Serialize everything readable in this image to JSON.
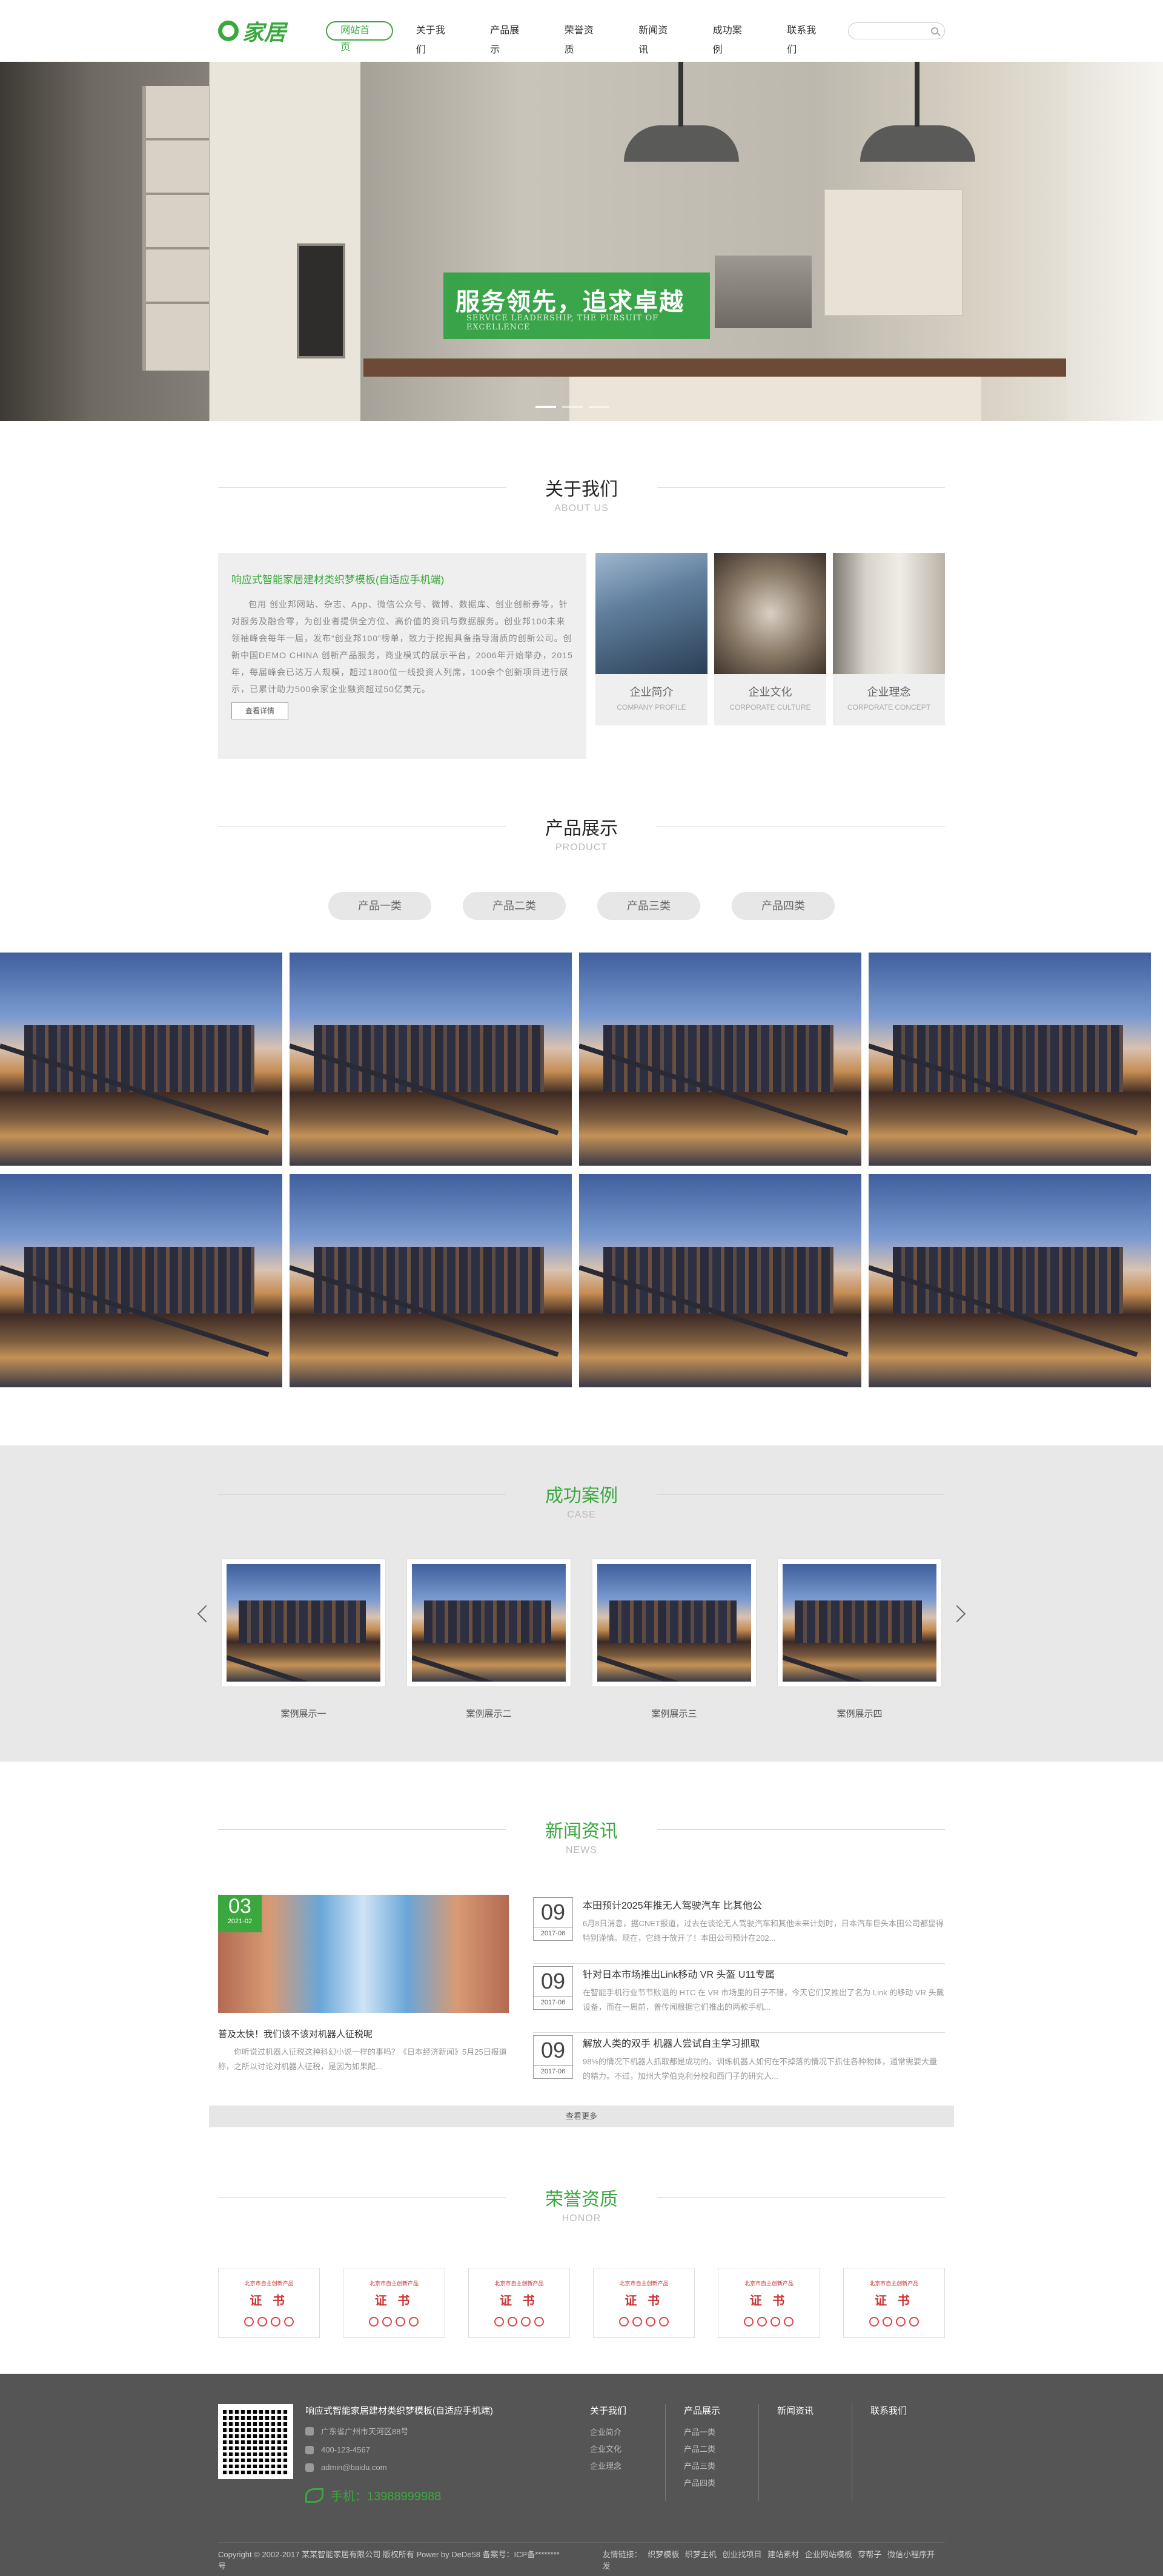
{
  "header": {
    "logo_text": "家居",
    "nav": [
      "网站首页",
      "关于我们",
      "产品展示",
      "荣誉资质",
      "新闻资讯",
      "成功案例",
      "联系我们"
    ],
    "search_placeholder": ""
  },
  "banner": {
    "title": "服务领先，追求卓越",
    "subtitle": "SERVICE LEADERSHIP, THE PURSUIT OF EXCELLENCE"
  },
  "about": {
    "title": "关于我们",
    "subtitle": "ABOUT US",
    "heading": "响应式智能家居建材类织梦模板(自适应手机端)",
    "text": "包用 创业邦网站、杂志、App、微信公众号、微博、数据库、创业创新券等，针对服务及融合零，为创业者提供全方位、高价值的资讯与数据服务。创业邦100未来领袖峰会每年一届，发布“创业邦100”榜单，致力于挖掘具备指导潜质的创新公司。创新中国DEMO CHINA 创新产品服务，商业模式的展示平台，2006年开始举办，2015年，每届峰会已达万人规模，超过1800位一线投资人列席，100余个创新项目进行展示，已累计助力500余家企业融资超过50亿美元。",
    "button": "查看详情",
    "cards": [
      {
        "title": "企业简介",
        "sub": "COMPANY PROFILE"
      },
      {
        "title": "企业文化",
        "sub": "CORPORATE CULTURE"
      },
      {
        "title": "企业理念",
        "sub": "CORPORATE CONCEPT"
      }
    ]
  },
  "product": {
    "title": "产品展示",
    "subtitle": "PRODUCT",
    "tabs": [
      "产品一类",
      "产品二类",
      "产品三类",
      "产品四类"
    ]
  },
  "case": {
    "title": "成功案例",
    "subtitle": "CASE",
    "items": [
      "案例展示一",
      "案例展示二",
      "案例展示三",
      "案例展示四"
    ]
  },
  "news": {
    "title": "新闻资讯",
    "subtitle": "NEWS",
    "feature": {
      "day": "03",
      "month": "2021-02",
      "title": "普及太快！我们该不该对机器人征税呢",
      "text": "你听说过机器人征税这种科幻小说一样的事吗？《日本经济新闻》5月25日报道称，之所以讨论对机器人征税，是因为如果配..."
    },
    "items": [
      {
        "day": "09",
        "month": "2017-06",
        "title": "本田预计2025年推无人驾驶汽车 比其他公",
        "text": "6月8日消息，据CNET报道，过去在谈论无人驾驶汽车和其他未来计划时，日本汽车巨头本田公司都显得特别谨慎。现在，它终于放开了！本田公司预计在202..."
      },
      {
        "day": "09",
        "month": "2017-06",
        "title": "针对日本市场推出Link移动 VR 头盔 U11专属",
        "text": "在智能手机行业节节败退的 HTC 在 VR 市场里的日子不错，今天它们又推出了名为 Link 的移动 VR 头戴设备，而在一周前，曾传闻根据它们推出的两款手机..."
      },
      {
        "day": "09",
        "month": "2017-06",
        "title": "解放人类的双手 机器人尝试自主学习抓取",
        "text": "98%的情况下机器人抓取都是成功的。训练机器人如何在不掉落的情况下抓住各种物体，通常需要大量的精力。不过，加州大学伯克利分校和西门子的研究人..."
      }
    ],
    "more": "查看更多"
  },
  "honor": {
    "title": "荣誉资质",
    "subtitle": "HONOR",
    "cert_top": "北京市自主创新产品",
    "cert_word": "证 书",
    "count": 6
  },
  "footer": {
    "company": "响应式智能家居建材类织梦模板(自适应手机端)",
    "address": "广东省广州市天河区88号",
    "tel": "400-123-4567",
    "email": "admin@baidu.com",
    "phone": "手机：13988999988",
    "cols": [
      {
        "title": "关于我们",
        "items": [
          "企业简介",
          "企业文化",
          "企业理念"
        ]
      },
      {
        "title": "产品展示",
        "items": [
          "产品一类",
          "产品二类",
          "产品三类",
          "产品四类"
        ]
      },
      {
        "title": "新闻资讯",
        "items": []
      },
      {
        "title": "联系我们",
        "items": []
      }
    ],
    "copyright": "Copyright © 2002-2017 某某智能家居有限公司 版权所有 Power by DeDe58 备案号：ICP备********号",
    "links_label": "友情链接：",
    "links": [
      "织梦模板",
      "织梦主机",
      "创业找项目",
      "建站素材",
      "企业网站模板",
      "穿帮子",
      "微信小程序开发"
    ]
  },
  "colors": {
    "accent": "#3aa83e",
    "footer_bg": "#555555"
  }
}
